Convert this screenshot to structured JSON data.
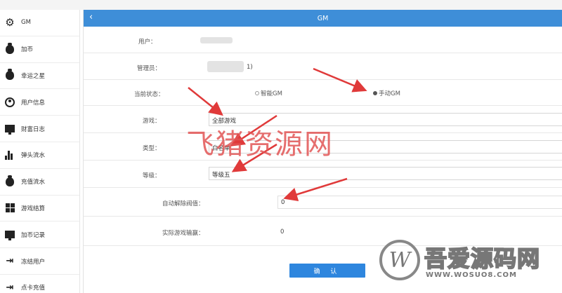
{
  "sidebar": {
    "items": [
      {
        "label": "GM",
        "icon": "gear-icon"
      },
      {
        "label": "加币",
        "icon": "money-bag-icon"
      },
      {
        "label": "幸运之星",
        "icon": "money-bag-icon"
      },
      {
        "label": "用户信息",
        "icon": "user-icon"
      },
      {
        "label": "财富日志",
        "icon": "monitor-icon"
      },
      {
        "label": "弹头流水",
        "icon": "bar-chart-icon"
      },
      {
        "label": "充值流水",
        "icon": "money-bag-icon"
      },
      {
        "label": "游戏结算",
        "icon": "grid-icon"
      },
      {
        "label": "加币记录",
        "icon": "monitor-icon"
      },
      {
        "label": "冻结用户",
        "icon": "exit-icon"
      },
      {
        "label": "点卡充值",
        "icon": "exit-icon"
      }
    ]
  },
  "header": {
    "title": "GM",
    "back_glyph": "‹"
  },
  "form": {
    "user_label": "用户：",
    "admin_label": "管理员：",
    "admin_value_suffix": "1)",
    "status_label": "当前状态：",
    "status_option_smart": "智能GM",
    "status_option_manual": "手动GM",
    "status_selected": "手动GM",
    "game_label": "游戏：",
    "game_value": "全部游戏",
    "type_label": "类型：",
    "type_value": "白名单",
    "level_label": "等级：",
    "level_value": "等级五",
    "threshold_label": "自动解除阀值：",
    "threshold_value": "0",
    "actual_label": "实际游戏输赢：",
    "actual_value": "0",
    "confirm_label": "确 认"
  },
  "overlays": {
    "watermark_text": "飞猪资源网",
    "logo_text": "吾爱源码网",
    "logo_url": "WWW.WOSUO8.COM",
    "logo_mark": "W"
  },
  "colors": {
    "header_bg": "#3e8ed8",
    "confirm_bg": "#2e86de",
    "arrow_red": "#e03a3a"
  }
}
